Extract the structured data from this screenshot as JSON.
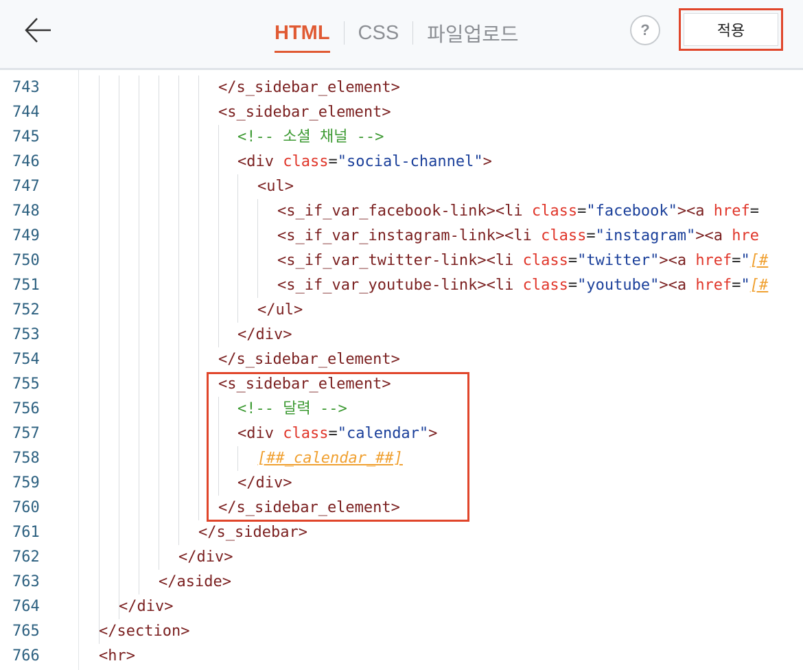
{
  "header": {
    "tabs": [
      {
        "label": "HTML",
        "active": true
      },
      {
        "label": "CSS",
        "active": false
      },
      {
        "label": "파일업로드",
        "active": false
      }
    ],
    "help_label": "?",
    "apply_label": "적용"
  },
  "colors": {
    "accent": "#e05a33",
    "highlight_border": "#e0452a",
    "line_number": "#2b5f7f",
    "tag": "#7a1f1f",
    "attribute": "#e0362a",
    "string": "#1a3f9a",
    "comment": "#3d9a33",
    "template_var": "#f0a030"
  },
  "editor": {
    "lines": [
      {
        "num": "743",
        "parts": [
          {
            "c": "tag",
            "t": "</s_sidebar_element>"
          }
        ]
      },
      {
        "num": "744",
        "parts": [
          {
            "c": "tag",
            "t": "<s_sidebar_element>"
          }
        ]
      },
      {
        "num": "745",
        "parts": [
          {
            "c": "cmt",
            "t": "<!-- 소셜 채널 -->"
          }
        ]
      },
      {
        "num": "746",
        "parts": [
          {
            "c": "tag",
            "t": "<div "
          },
          {
            "c": "attr",
            "t": "class"
          },
          {
            "c": "plain",
            "t": "="
          },
          {
            "c": "str",
            "t": "\"social-channel\""
          },
          {
            "c": "tag",
            "t": ">"
          }
        ]
      },
      {
        "num": "747",
        "parts": [
          {
            "c": "tag",
            "t": "<ul>"
          }
        ]
      },
      {
        "num": "748",
        "parts": [
          {
            "c": "tag",
            "t": "<s_if_var_facebook-link><li "
          },
          {
            "c": "attr",
            "t": "class"
          },
          {
            "c": "plain",
            "t": "="
          },
          {
            "c": "str",
            "t": "\"facebook\""
          },
          {
            "c": "tag",
            "t": "><a "
          },
          {
            "c": "attr",
            "t": "href"
          },
          {
            "c": "plain",
            "t": "="
          }
        ]
      },
      {
        "num": "749",
        "parts": [
          {
            "c": "tag",
            "t": "<s_if_var_instagram-link><li "
          },
          {
            "c": "attr",
            "t": "class"
          },
          {
            "c": "plain",
            "t": "="
          },
          {
            "c": "str",
            "t": "\"instagram\""
          },
          {
            "c": "tag",
            "t": "><a "
          },
          {
            "c": "attr",
            "t": "hre"
          }
        ]
      },
      {
        "num": "750",
        "parts": [
          {
            "c": "tag",
            "t": "<s_if_var_twitter-link><li "
          },
          {
            "c": "attr",
            "t": "class"
          },
          {
            "c": "plain",
            "t": "="
          },
          {
            "c": "str",
            "t": "\"twitter\""
          },
          {
            "c": "tag",
            "t": "><a "
          },
          {
            "c": "attr",
            "t": "href"
          },
          {
            "c": "plain",
            "t": "="
          },
          {
            "c": "str",
            "t": "\""
          },
          {
            "c": "tpl",
            "t": "[#"
          }
        ]
      },
      {
        "num": "751",
        "parts": [
          {
            "c": "tag",
            "t": "<s_if_var_youtube-link><li "
          },
          {
            "c": "attr",
            "t": "class"
          },
          {
            "c": "plain",
            "t": "="
          },
          {
            "c": "str",
            "t": "\"youtube\""
          },
          {
            "c": "tag",
            "t": "><a "
          },
          {
            "c": "attr",
            "t": "href"
          },
          {
            "c": "plain",
            "t": "="
          },
          {
            "c": "str",
            "t": "\""
          },
          {
            "c": "tpl",
            "t": "[#"
          }
        ]
      },
      {
        "num": "752",
        "parts": [
          {
            "c": "tag",
            "t": "</ul>"
          }
        ]
      },
      {
        "num": "753",
        "parts": [
          {
            "c": "tag",
            "t": "</div>"
          }
        ]
      },
      {
        "num": "754",
        "parts": [
          {
            "c": "tag",
            "t": "</s_sidebar_element>"
          }
        ]
      },
      {
        "num": "755",
        "parts": [
          {
            "c": "tag",
            "t": "<s_sidebar_element>"
          }
        ]
      },
      {
        "num": "756",
        "parts": [
          {
            "c": "cmt",
            "t": "<!-- 달력 -->"
          }
        ]
      },
      {
        "num": "757",
        "parts": [
          {
            "c": "tag",
            "t": "<div "
          },
          {
            "c": "attr",
            "t": "class"
          },
          {
            "c": "plain",
            "t": "="
          },
          {
            "c": "str",
            "t": "\"calendar\""
          },
          {
            "c": "tag",
            "t": ">"
          }
        ]
      },
      {
        "num": "758",
        "parts": [
          {
            "c": "tpl",
            "t": "[##_calendar_##]"
          }
        ]
      },
      {
        "num": "759",
        "parts": [
          {
            "c": "tag",
            "t": "</div>"
          }
        ]
      },
      {
        "num": "760",
        "parts": [
          {
            "c": "tag",
            "t": "</s_sidebar_element>"
          }
        ]
      },
      {
        "num": "761",
        "parts": [
          {
            "c": "tag",
            "t": "</s_sidebar>"
          }
        ]
      },
      {
        "num": "762",
        "parts": [
          {
            "c": "tag",
            "t": "</div>"
          }
        ]
      },
      {
        "num": "763",
        "parts": [
          {
            "c": "tag",
            "t": "</aside>"
          }
        ]
      },
      {
        "num": "764",
        "parts": [
          {
            "c": "tag",
            "t": "</div>"
          }
        ]
      },
      {
        "num": "765",
        "parts": [
          {
            "c": "tag",
            "t": "</section>"
          }
        ]
      },
      {
        "num": "766",
        "parts": [
          {
            "c": "tag",
            "t": "<hr>"
          }
        ]
      }
    ]
  }
}
